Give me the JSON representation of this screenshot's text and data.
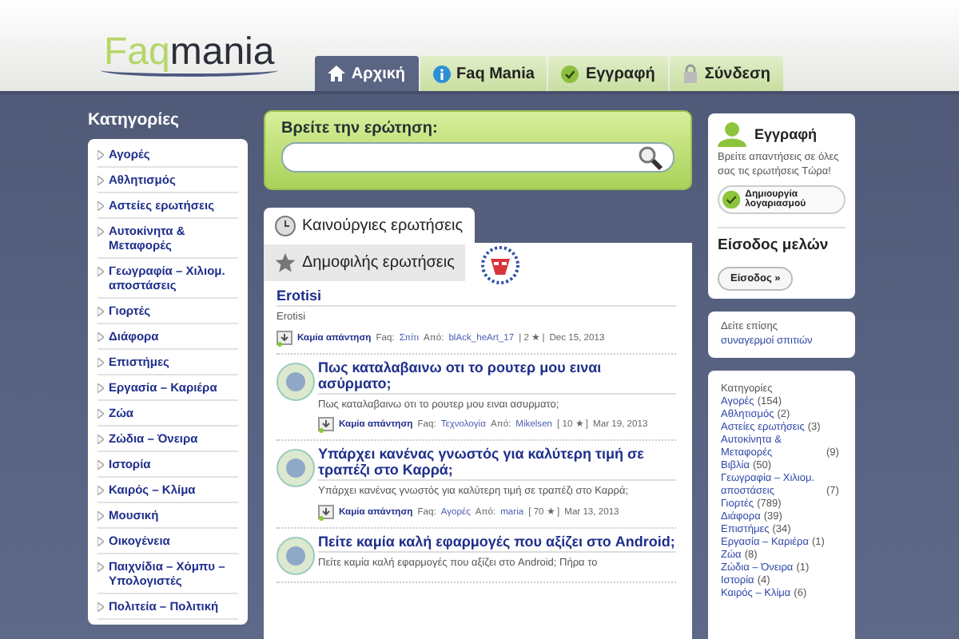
{
  "logo": {
    "light": "Faq",
    "dark": "mania"
  },
  "nav_tabs": [
    {
      "label": "Αρχική",
      "kind": "home",
      "selected": true
    },
    {
      "label": "Faq Mania",
      "kind": "info",
      "selected": false
    },
    {
      "label": "Εγγραφή",
      "kind": "check",
      "selected": false
    },
    {
      "label": "Σύνδεση",
      "kind": "lock",
      "selected": false
    }
  ],
  "sidebar": {
    "title": "Κατηγορίες",
    "items": [
      "Αγορές",
      "Αθλητισμός",
      "Αστείες ερωτήσεις",
      "Αυτοκίνητα & Μεταφορές",
      "Γεωγραφία – Χιλιομ. αποστάσεις",
      "Γιορτές",
      "Διάφορα",
      "Επιστήμες",
      "Εργασία – Καριέρα",
      "Ζώα",
      "Ζώδια – Όνειρα",
      "Ιστορία",
      "Καιρός – Κλίμα",
      "Μουσική",
      "Οικογένεια",
      "Παιχνίδια – Χόμπυ – Υπολογιστές",
      "Πολιτεία – Πολιτική"
    ]
  },
  "search": {
    "label": "Βρείτε την ερώτηση:"
  },
  "content_tabs": [
    {
      "label": "Καινούργιες ερωτήσεις",
      "kind": "clock",
      "selected": true
    },
    {
      "label": "Δημοφιλής ερωτήσεις",
      "kind": "star",
      "selected": false
    }
  ],
  "posts": [
    {
      "kind": "mask",
      "title": "Erotisi",
      "excerpt": "Erotisi",
      "status": "Καμία απάντηση",
      "faq_label": "Faq:",
      "category": "Σπίτι",
      "by_label": "Από:",
      "author": "blAck_heArt_17",
      "points": "| 2 ★ |",
      "date": "Dec 15, 2013"
    },
    {
      "kind": "globe",
      "title": "Πως καταλαβαινω οτι το ρουτερ μου ειναι ασύρματο;",
      "excerpt": "Πως καταλαβαινω οτι το ρουτερ μου ειναι ασυρματο;",
      "status": "Καμία απάντηση",
      "faq_label": "Faq:",
      "category": "Τεχνολογία",
      "by_label": "Από:",
      "author": "Mikelsen",
      "points": "[ 10 ★ ]",
      "date": "Mar 19, 2013"
    },
    {
      "kind": "globe",
      "title": "Υπάρχει κανένας γνωστός για καλύτερη τιμή σε τραπέζι στο Καρρά;",
      "excerpt": "Υπάρχει κανένας γνωστός για καλύτερη τιμή σε τραπέζι στο Καρρά;",
      "status": "Καμία απάντηση",
      "faq_label": "Faq:",
      "category": "Αγορές",
      "by_label": "Από:",
      "author": "maria",
      "points": "[ 70 ★ ]",
      "date": "Mar 13, 2013"
    },
    {
      "kind": "globe",
      "title": "Πείτε καμία καλή εφαρμογές που αξίζει στο Android;",
      "excerpt": "Πείτε καμία καλή εφαρμογές που αξίζει στο Android; Πήρα το"
    }
  ],
  "register": {
    "title": "Εγγραφή",
    "text": "Βρείτε απαντήσεις σε όλες σας τις ερωτήσεις Τώρα!",
    "button": "Δημιουργία λογαριασμού"
  },
  "login": {
    "title": "Είσοδος μελών",
    "button": "Είσοδος »"
  },
  "see_also": {
    "label": "Δείτε επίσης",
    "link": "συναγερμοί σπιτιών"
  },
  "categories_box": {
    "title": "Κατηγορίες",
    "items": [
      {
        "name": "Αγορές",
        "count": "(154)"
      },
      {
        "name": "Αθλητισμός",
        "count": "(2)"
      },
      {
        "name": "Αστείες ερωτήσεις",
        "count": "(3)"
      },
      {
        "name": "Αυτοκίνητα & Μεταφορές",
        "count": "(9)"
      },
      {
        "name": "Βιβλία",
        "count": "(50)"
      },
      {
        "name": "Γεωγραφία – Χιλιομ. αποστάσεις",
        "count": "(7)"
      },
      {
        "name": "Γιορτές",
        "count": "(789)"
      },
      {
        "name": "Διάφορα",
        "count": "(39)"
      },
      {
        "name": "Επιστήμες",
        "count": "(34)"
      },
      {
        "name": "Εργασία – Καριέρα",
        "count": "(1)"
      },
      {
        "name": "Ζώα",
        "count": "(8)"
      },
      {
        "name": "Ζώδια – Όνειρα",
        "count": "(1)"
      },
      {
        "name": "Ιστορία",
        "count": "(4)"
      },
      {
        "name": "Καιρός – Κλίμα",
        "count": "(6)"
      }
    ]
  }
}
